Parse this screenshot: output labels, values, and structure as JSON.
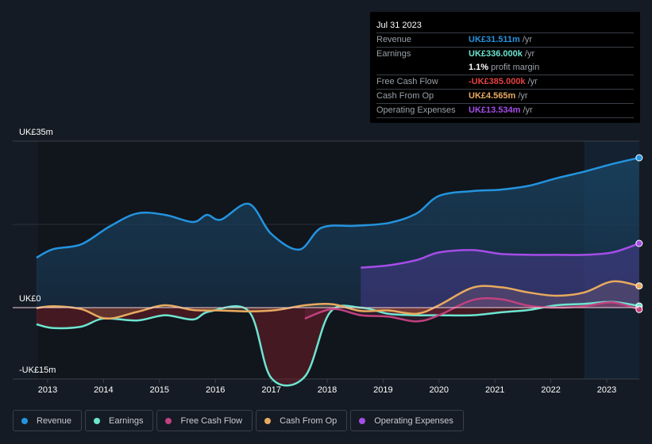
{
  "tooltip": {
    "date": "Jul 31 2023",
    "rows": [
      {
        "label": "Revenue",
        "value": "UK£31.511m",
        "unit": "/yr",
        "color": "#2394df"
      },
      {
        "label": "Earnings",
        "value": "UK£336.000k",
        "unit": "/yr",
        "color": "#6ce5d0"
      },
      {
        "label": "",
        "value": "1.1%",
        "unit": "profit margin",
        "color": "#ffffff"
      },
      {
        "label": "Free Cash Flow",
        "value": "-UK£385.000k",
        "unit": "/yr",
        "color": "#e64141"
      },
      {
        "label": "Cash From Op",
        "value": "UK£4.565m",
        "unit": "/yr",
        "color": "#e8aa5f"
      },
      {
        "label": "Operating Expenses",
        "value": "UK£13.534m",
        "unit": "/yr",
        "color": "#a54de8"
      }
    ]
  },
  "legend": [
    {
      "label": "Revenue",
      "color": "#2394df"
    },
    {
      "label": "Earnings",
      "color": "#6ce5d0"
    },
    {
      "label": "Free Cash Flow",
      "color": "#c2417f"
    },
    {
      "label": "Cash From Op",
      "color": "#e8aa5f"
    },
    {
      "label": "Operating Expenses",
      "color": "#a54de8"
    }
  ],
  "chart_data": {
    "type": "line",
    "title": "",
    "xlabel": "",
    "ylabel": "",
    "y_tick_labels": [
      "UK£35m",
      "UK£0",
      "-UK£15m"
    ],
    "y_ticks": [
      35,
      0,
      -15
    ],
    "ylim": [
      -15,
      35
    ],
    "xlim": [
      2012.8,
      2023.58
    ],
    "x_tick_labels": [
      "2013",
      "2014",
      "2015",
      "2016",
      "2017",
      "2018",
      "2019",
      "2020",
      "2021",
      "2022",
      "2023"
    ],
    "x_ticks": [
      2013,
      2014,
      2015,
      2016,
      2017,
      2018,
      2019,
      2020,
      2021,
      2022,
      2023
    ],
    "forecast_shade_start": 2022.6,
    "series": [
      {
        "name": "Revenue",
        "color": "#2394df",
        "x": [
          2012.8,
          2013.1,
          2013.6,
          2014.1,
          2014.6,
          2015.1,
          2015.6,
          2015.85,
          2016.1,
          2016.6,
          2017.0,
          2017.5,
          2017.9,
          2018.5,
          2019.1,
          2019.6,
          2020.0,
          2020.6,
          2021.1,
          2021.6,
          2022.1,
          2022.6,
          2023.1,
          2023.58
        ],
        "y": [
          10.5,
          12.3,
          13.3,
          17.0,
          19.8,
          19.5,
          18.0,
          19.5,
          18.5,
          21.8,
          15.5,
          12.2,
          16.8,
          17.2,
          17.8,
          19.8,
          23.5,
          24.5,
          24.8,
          25.6,
          27.2,
          28.6,
          30.2,
          31.5
        ]
      },
      {
        "name": "Earnings",
        "color": "#6ce5d0",
        "x": [
          2012.8,
          2013.1,
          2013.6,
          2014.0,
          2014.6,
          2015.1,
          2015.6,
          2015.9,
          2016.6,
          2017.0,
          2017.6,
          2018.05,
          2018.6,
          2019.1,
          2019.6,
          2020.0,
          2020.6,
          2021.1,
          2021.6,
          2022.1,
          2022.6,
          2023.1,
          2023.58
        ],
        "y": [
          -3.5,
          -4.3,
          -4.0,
          -2.3,
          -2.7,
          -1.6,
          -2.5,
          -0.8,
          -0.8,
          -14.8,
          -14.5,
          -1.0,
          0.0,
          -1.3,
          -1.6,
          -1.6,
          -1.6,
          -1.0,
          -0.5,
          0.5,
          0.8,
          1.2,
          0.34
        ]
      },
      {
        "name": "Free Cash Flow",
        "color": "#c2417f",
        "x": [
          2017.6,
          2018.1,
          2018.6,
          2019.1,
          2019.6,
          2020.0,
          2020.6,
          2021.1,
          2021.6,
          2022.1,
          2022.6,
          2023.1,
          2023.58
        ],
        "y": [
          -2.3,
          -0.3,
          -1.6,
          -1.9,
          -2.9,
          -1.6,
          1.6,
          1.8,
          0.4,
          0.0,
          0.3,
          1.1,
          -0.385
        ]
      },
      {
        "name": "Cash From Op",
        "color": "#e8aa5f",
        "x": [
          2012.8,
          2013.1,
          2013.6,
          2014.05,
          2014.6,
          2015.1,
          2015.6,
          2016.1,
          2016.6,
          2017.1,
          2017.6,
          2018.1,
          2018.6,
          2019.1,
          2019.6,
          2020.0,
          2020.6,
          2021.1,
          2021.6,
          2022.1,
          2022.6,
          2023.1,
          2023.58
        ],
        "y": [
          -0.1,
          0.3,
          -0.3,
          -2.3,
          -0.9,
          0.5,
          -0.5,
          -0.6,
          -0.8,
          -0.5,
          0.5,
          0.7,
          -0.7,
          -0.6,
          -1.3,
          0.5,
          4.2,
          4.3,
          3.2,
          2.5,
          3.2,
          5.5,
          4.565
        ]
      },
      {
        "name": "Operating Expenses",
        "color": "#a54de8",
        "x": [
          2018.6,
          2019.1,
          2019.6,
          2020.0,
          2020.6,
          2021.1,
          2021.6,
          2022.1,
          2022.6,
          2023.1,
          2023.58
        ],
        "y": [
          8.4,
          8.9,
          10.0,
          11.6,
          12.1,
          11.3,
          11.1,
          11.1,
          11.1,
          11.6,
          13.5
        ]
      }
    ]
  }
}
